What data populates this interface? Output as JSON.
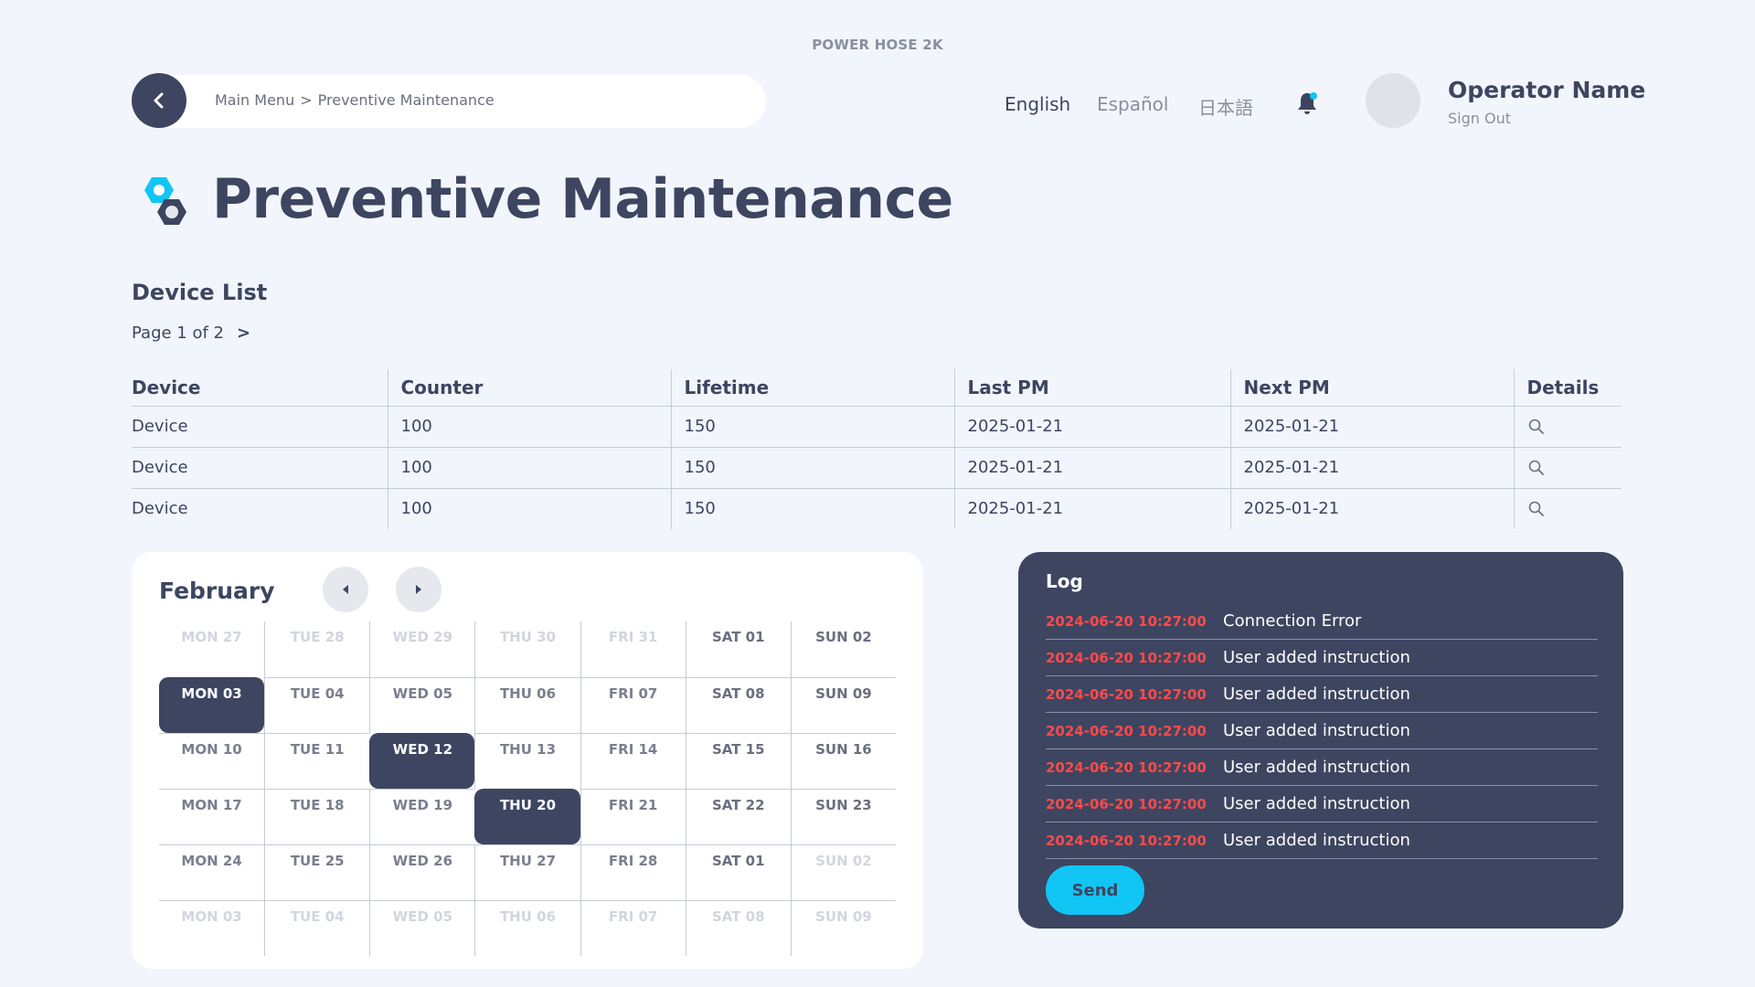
{
  "app_title": "POWER HOSE 2K",
  "breadcrumb": {
    "root": "Main Menu",
    "separator": ">",
    "current": "Preventive Maintenance"
  },
  "languages": [
    "English",
    "Español",
    "日本語"
  ],
  "user": {
    "name": "Operator Name",
    "sign_out": "Sign Out"
  },
  "page": {
    "title": "Preventive Maintenance"
  },
  "device_list": {
    "title": "Device List",
    "pager": "Page 1 of 2",
    "pager_next": ">",
    "columns": [
      "Device",
      "Counter",
      "Lifetime",
      "Last PM",
      "Next PM",
      "Details"
    ],
    "rows": [
      [
        "Device",
        "100",
        "150",
        "2025-01-21",
        "2025-01-21"
      ],
      [
        "Device",
        "100",
        "150",
        "2025-01-21",
        "2025-01-21"
      ],
      [
        "Device",
        "100",
        "150",
        "2025-01-21",
        "2025-01-21"
      ]
    ]
  },
  "calendar": {
    "month": "February",
    "days": [
      [
        "MON 27",
        "TUE 28",
        "WED 29",
        "THU 30",
        "FRI 31",
        "SAT 01",
        "SUN 02"
      ],
      [
        "MON 03",
        "TUE 04",
        "WED 05",
        "THU 06",
        "FRI 07",
        "SAT 08",
        "SUN 09"
      ],
      [
        "MON 10",
        "TUE 11",
        "WED 12",
        "THU 13",
        "FRI 14",
        "SAT 15",
        "SUN 16"
      ],
      [
        "MON 17",
        "TUE 18",
        "WED 19",
        "THU 20",
        "FRI 21",
        "SAT 22",
        "SUN 23"
      ],
      [
        "MON 24",
        "TUE 25",
        "WED 26",
        "THU 27",
        "FRI 28",
        "SAT 01",
        "SUN 02"
      ],
      [
        "MON 03",
        "TUE 04",
        "WED 05",
        "THU 06",
        "FRI 07",
        "SAT 08",
        "SUN 09"
      ]
    ],
    "selected": [
      "1-0",
      "2-2",
      "3-3"
    ],
    "muted": [
      "0-0",
      "0-1",
      "0-2",
      "0-3",
      "0-4",
      "4-6",
      "5-0",
      "5-1",
      "5-2",
      "5-3",
      "5-4",
      "5-5",
      "5-6"
    ]
  },
  "log": {
    "title": "Log",
    "entries": [
      {
        "time": "2024-06-20 10:27:00",
        "message": "Connection Error"
      },
      {
        "time": "2024-06-20 10:27:00",
        "message": "User added instruction"
      },
      {
        "time": "2024-06-20 10:27:00",
        "message": "User added instruction"
      },
      {
        "time": "2024-06-20 10:27:00",
        "message": "User added instruction"
      },
      {
        "time": "2024-06-20 10:27:00",
        "message": "User added instruction"
      },
      {
        "time": "2024-06-20 10:27:00",
        "message": "User added instruction"
      },
      {
        "time": "2024-06-20 10:27:00",
        "message": "User added instruction"
      }
    ],
    "send_label": "Send"
  },
  "colors": {
    "primary": "#3d4560",
    "accent": "#11c5f5",
    "error": "#ff4a4a",
    "background": "#f2f6fc"
  },
  "icons": [
    "back-arrow-icon",
    "bell-icon",
    "hex-nut-icon",
    "search-icon",
    "chevron-left-icon",
    "chevron-right-icon"
  ]
}
